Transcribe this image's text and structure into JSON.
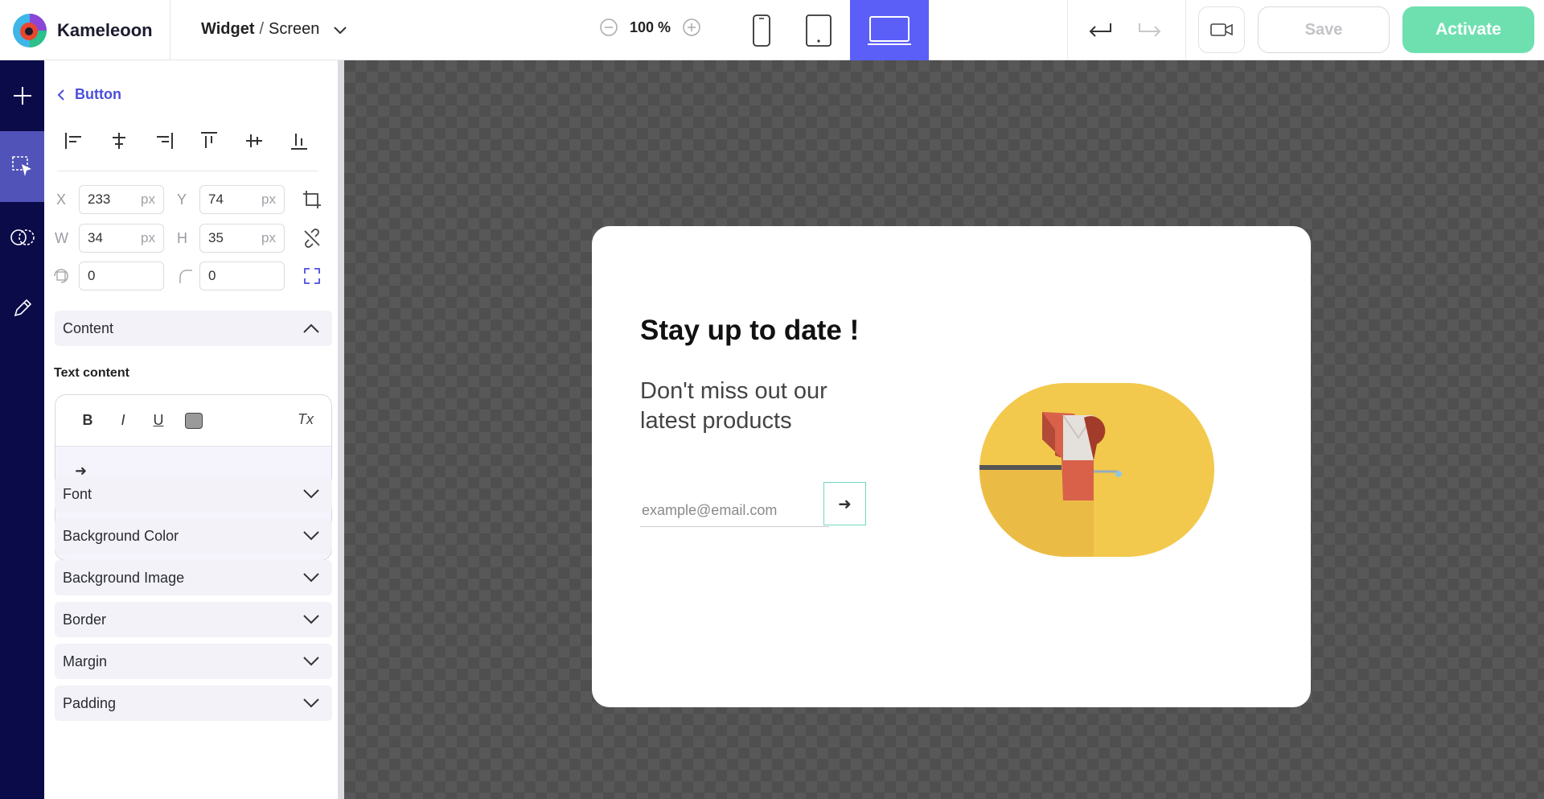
{
  "app": {
    "brand": "Kameleoon"
  },
  "breadcrumb": {
    "section": "Widget",
    "separator": "/",
    "current": "Screen"
  },
  "zoom": {
    "level": "100 %"
  },
  "toolbar": {
    "save_label": "Save",
    "activate_label": "Activate"
  },
  "devices": {
    "active": "desktop"
  },
  "panel": {
    "back_label": "Button",
    "x": {
      "label": "X",
      "value": "233",
      "unit": "px"
    },
    "y": {
      "label": "Y",
      "value": "74",
      "unit": "px"
    },
    "w": {
      "label": "W",
      "value": "34",
      "unit": "px"
    },
    "h": {
      "label": "H",
      "value": "35",
      "unit": "px"
    },
    "rotation": {
      "value": "0"
    },
    "radius": {
      "value": "0"
    },
    "content_section": "Content",
    "text_content_label": "Text content",
    "editor": {
      "bold": "B",
      "italic": "I",
      "underline": "U",
      "clear": "Tx",
      "content": "➜"
    },
    "sections": [
      "Font",
      "Background Color",
      "Background Image",
      "Border",
      "Margin",
      "Padding"
    ]
  },
  "widget": {
    "title": "Stay up to date !",
    "subtitle": "Don't miss out our latest products",
    "email_placeholder": "example@email.com",
    "button_content": "➜"
  },
  "colors": {
    "accent": "#5b5ff8",
    "rail": "#0b0b4a",
    "activate": "#6ee0b0",
    "link": "#4c4fd9",
    "illustration_yellow": "#f2c94c",
    "illustration_red": "#d9614a"
  }
}
